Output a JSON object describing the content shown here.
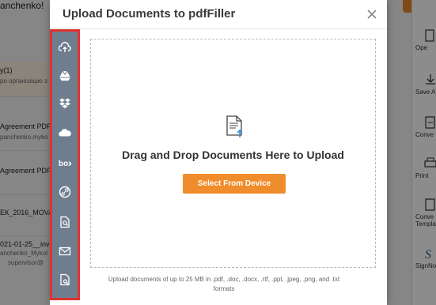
{
  "background": {
    "top_left": "anchenko!",
    "left_rows": [
      {
        "title": "y(1)",
        "subtitle": "ро організацію з"
      },
      {
        "title": "Agreement PDF(2",
        "subtitle": "panchenko.myko"
      },
      {
        "title": "Agreement PDF.p",
        "subtitle": ""
      },
      {
        "title": "ЕК_2016_MOVA",
        "subtitle": ""
      },
      {
        "title": "021-01-25__inv",
        "subtitle": "anchenko_Mykol"
      },
      {
        "title": "",
        "subtitle": "supervisor@"
      }
    ],
    "right_panel": [
      {
        "label": "Ope",
        "icon": "open-icon"
      },
      {
        "label": "Save A",
        "icon": "save-icon"
      },
      {
        "label": "Conve",
        "icon": "convert-icon"
      },
      {
        "label": "Print",
        "icon": "print-icon"
      },
      {
        "label": "Conve Templa",
        "icon": "template-icon"
      },
      {
        "label": "SignNo",
        "icon": "signnow-icon"
      }
    ]
  },
  "modal": {
    "title": "Upload Documents to pdfFiller",
    "close_icon": "close-icon",
    "sidebar_icons": [
      "upload-cloud-icon",
      "google-drive-icon",
      "dropbox-icon",
      "onedrive-icon",
      "box-icon",
      "link-icon",
      "search-document-icon",
      "email-icon",
      "document-search-icon"
    ],
    "box_label": "box",
    "drop_text": "Drag and Drop Documents Here to Upload",
    "select_button": "Select From Device",
    "footer_note": "Upload documents of up to 25 MB in .pdf, .doc, .docx, .rtf, .ppt, .jpeg, .png, and .txt formats"
  },
  "colors": {
    "accent_orange": "#f08c2c",
    "sidebar_bg": "#6f7e8f",
    "highlight_red": "#e0322f"
  }
}
